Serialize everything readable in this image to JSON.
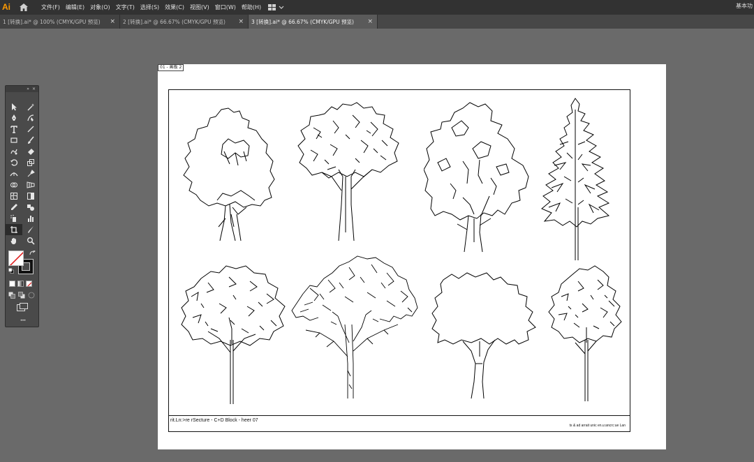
{
  "app": {
    "logo": "Ai"
  },
  "menu": [
    {
      "label": "文件(F)",
      "name": "menu-file"
    },
    {
      "label": "编辑(E)",
      "name": "menu-edit"
    },
    {
      "label": "对象(O)",
      "name": "menu-object"
    },
    {
      "label": "文字(T)",
      "name": "menu-type"
    },
    {
      "label": "选择(S)",
      "name": "menu-select"
    },
    {
      "label": "效果(C)",
      "name": "menu-effect"
    },
    {
      "label": "视图(V)",
      "name": "menu-view"
    },
    {
      "label": "窗口(W)",
      "name": "menu-window"
    },
    {
      "label": "帮助(H)",
      "name": "menu-help"
    }
  ],
  "workspace": {
    "label": "基本功"
  },
  "tabs": [
    {
      "label": "1 [转换].ai* @ 100% (CMYK/GPU 预览)",
      "active": false
    },
    {
      "label": "2 [转换].ai* @ 66.67% (CMYK/GPU 预览)",
      "active": false
    },
    {
      "label": "3 [转换].ai* @ 66.67% (CMYK/GPU 预览)",
      "active": true
    }
  ],
  "tab_close": "×",
  "toolbar": {
    "collapse": "»",
    "close": "×",
    "more": "•••"
  },
  "artboard": {
    "label": "01 - 画板 2",
    "title_left": "rit.Ln:>re rSecture - C+D Block - heer 07",
    "title_right": "ts & ad arrait unic  en.u:ancrc:ue Lan"
  },
  "colors": {
    "menubar": "#323232",
    "tabbar": "#474747",
    "canvas": "#6a6a6a",
    "logo": "#ff9a00"
  }
}
